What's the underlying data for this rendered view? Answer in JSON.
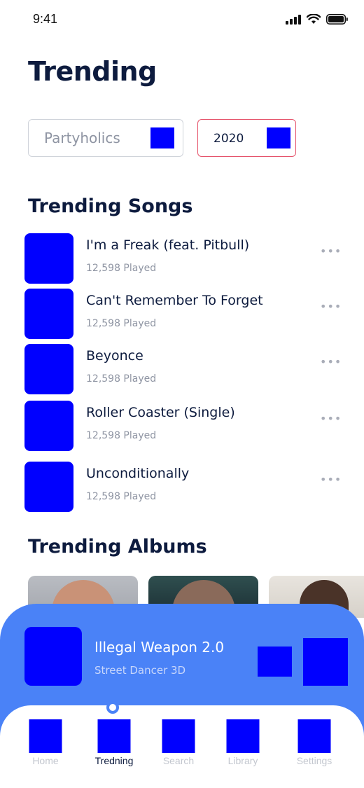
{
  "status_bar": {
    "time": "9:41"
  },
  "header": {
    "title": "Trending"
  },
  "filters": {
    "genre": "Partyholics",
    "year": "2020"
  },
  "songs_section": {
    "title": "Trending Songs",
    "items": [
      {
        "title": "I'm a Freak (feat. Pitbull)",
        "played": "12,598 Played",
        "more": "•••"
      },
      {
        "title": "Can't Remember To Forget",
        "played": "12,598 Played",
        "more": "•••"
      },
      {
        "title": "Beyonce",
        "played": "12,598 Played",
        "more": "•••"
      },
      {
        "title": "Roller Coaster (Single)",
        "played": "12,598 Played",
        "more": "•••"
      },
      {
        "title": "Unconditionally",
        "played": "12,598 Played",
        "more": "•••"
      }
    ]
  },
  "albums_section": {
    "title": "Trending Albums"
  },
  "now_playing": {
    "title": "Illegal Weapon 2.0",
    "subtitle": "Street Dancer 3D"
  },
  "nav": {
    "items": [
      {
        "label": "Home",
        "icon": "home-icon"
      },
      {
        "label": "Tredning",
        "icon": "trending-icon"
      },
      {
        "label": "Search",
        "icon": "search-icon"
      },
      {
        "label": "Library",
        "icon": "library-icon"
      },
      {
        "label": "Settings",
        "icon": "settings-icon"
      }
    ],
    "active": "Tredning"
  },
  "colors": {
    "accent": "#4a82f7",
    "title": "#0d1b3e",
    "year_border": "#e5526a",
    "muted": "#8f95a3"
  }
}
